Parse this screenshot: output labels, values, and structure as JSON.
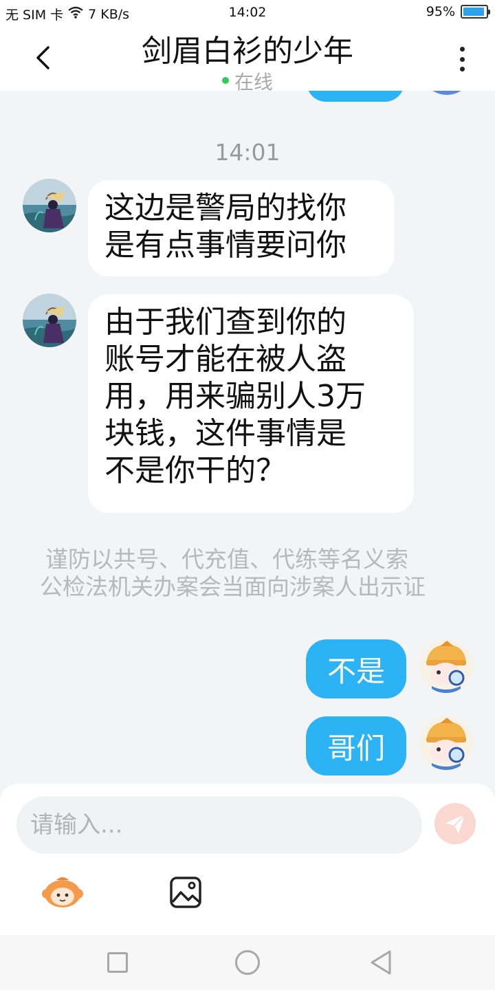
{
  "status_bar": {
    "carrier": "无 SIM 卡",
    "speed": "7 KB/s",
    "time": "14:02",
    "battery": "95%",
    "battery_level": 0.95
  },
  "header": {
    "title": "剑眉白衫的少年",
    "status": "在线",
    "back_icon": "chevron-left-icon",
    "more_icon": "more-vertical-icon"
  },
  "chat": {
    "time_separator": "14:01",
    "incoming": [
      {
        "text": "这边是警局的找你\n是有点事情要问你"
      },
      {
        "text": "由于我们查到你的\n账号才能在被人盗\n用，用来骗别人3万\n块钱，这件事情是\n不是你干的？"
      }
    ],
    "notice": {
      "line1": "谨防以共号、代充值、代练等名义索",
      "line2": "公检法机关办案会当面向涉案人出示证"
    },
    "outgoing": [
      {
        "text": "不是"
      },
      {
        "text": "哥们"
      }
    ]
  },
  "composer": {
    "placeholder": "请输入...",
    "send_icon": "send-icon",
    "emoji_icon": "mascot-icon",
    "image_icon": "image-icon"
  },
  "nav_bar": {
    "recent_icon": "square-icon",
    "home_icon": "circle-icon",
    "back_icon": "triangle-back-icon"
  },
  "colors": {
    "outgoing_bubble": "#2cb3f6",
    "incoming_bubble": "#ffffff",
    "background": "#f3f4f6",
    "online_dot": "#2ecc52",
    "send_button": "#fbd7d2"
  }
}
